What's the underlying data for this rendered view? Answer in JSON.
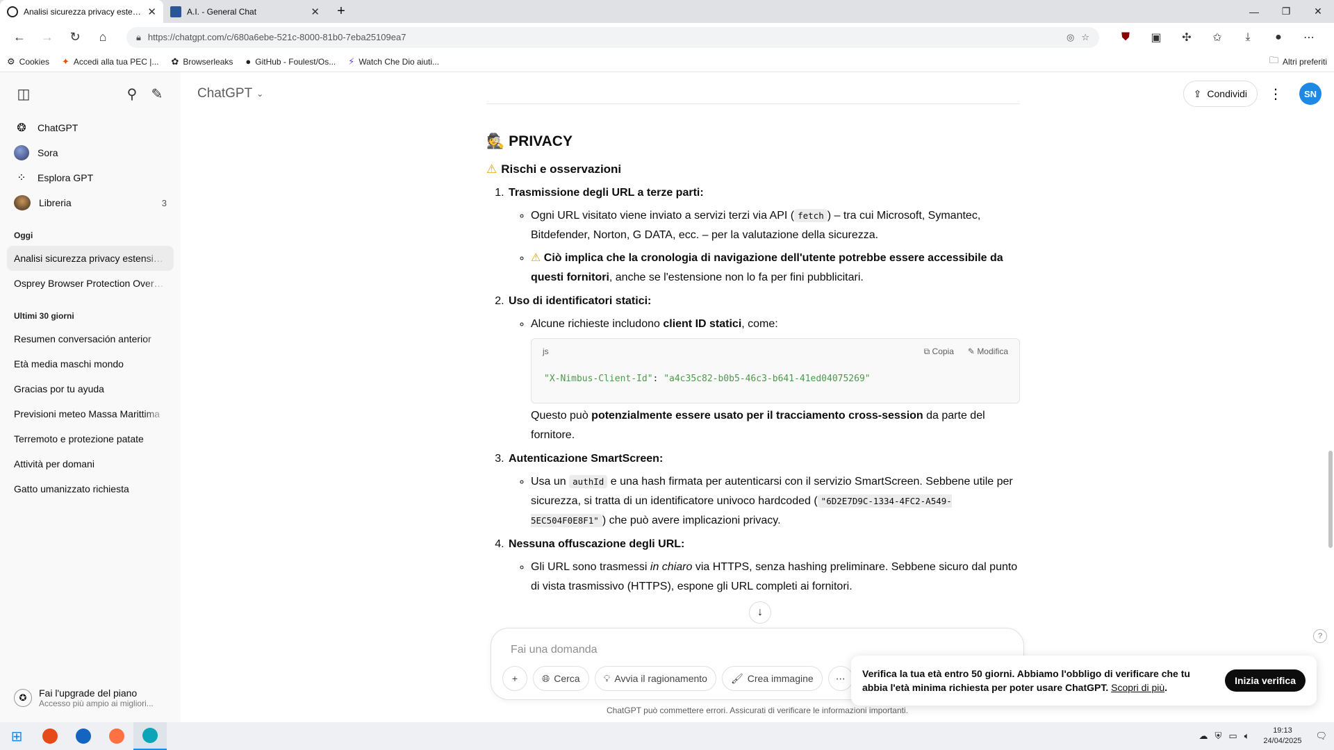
{
  "browser": {
    "tabs": [
      {
        "title": "Analisi sicurezza privacy estensior",
        "active": true
      },
      {
        "title": "A.I. - General Chat",
        "active": false
      }
    ],
    "url": "https://chatgpt.com/c/680a6ebe-521c-8000-81b0-7eba25109ea7",
    "bookmarks": [
      {
        "label": "Cookies",
        "icon": "gear-icon"
      },
      {
        "label": "Accedi alla tua PEC |...",
        "icon": "star-icon"
      },
      {
        "label": "Browserleaks",
        "icon": "blob-icon"
      },
      {
        "label": "GitHub - Foulest/Os...",
        "icon": "github-icon"
      },
      {
        "label": "Watch Che Dio aiuti...",
        "icon": "bolt-icon"
      }
    ],
    "other_bookmarks": "Altri preferiti"
  },
  "sidebar": {
    "items": [
      {
        "label": "ChatGPT"
      },
      {
        "label": "Sora"
      },
      {
        "label": "Esplora GPT"
      },
      {
        "label": "Libreria",
        "count": "3"
      }
    ],
    "sections": [
      {
        "title": "Oggi",
        "chats": [
          "Analisi sicurezza privacy estensione",
          "Osprey Browser Protection Overview"
        ]
      },
      {
        "title": "Ultimi 30 giorni",
        "chats": [
          "Resumen conversación anterior",
          "Età media maschi mondo",
          "Gracias por tu ayuda",
          "Previsioni meteo Massa Marittima",
          "Terremoto e protezione patate",
          "Attività per domani",
          "Gatto umanizzato richiesta"
        ]
      }
    ],
    "upgrade": {
      "title": "Fai l'upgrade del piano",
      "subtitle": "Accesso più ampio ai migliori..."
    }
  },
  "header": {
    "model": "ChatGPT",
    "share": "Condividi",
    "avatar": "SN"
  },
  "content": {
    "heading": "PRIVACY",
    "subheading": "Rischi e osservazioni",
    "p1_title": "Trasmissione degli URL a terze parti:",
    "p1_b1_a": "Ogni URL visitato viene inviato a servizi terzi via API (",
    "p1_b1_code": "fetch",
    "p1_b1_b": ") – tra cui Microsoft, Symantec, Bitdefender, Norton, G DATA, ecc. – per la valutazione della sicurezza.",
    "p1_b2_bold": "Ciò implica che la cronologia di navigazione dell'utente potrebbe essere accessibile da questi fornitori",
    "p1_b2_rest": ", anche se l'estensione non lo fa per fini pubblicitari.",
    "p2_title": "Uso di identificatori statici:",
    "p2_b1_a": "Alcune richieste includono ",
    "p2_b1_bold": "client ID statici",
    "p2_b1_b": ", come:",
    "code_lang": "js",
    "code_copy": "Copia",
    "code_edit": "Modifica",
    "code_line_key": "\"X-Nimbus-Client-Id\"",
    "code_line_sep": ": ",
    "code_line_val": "\"a4c35c82-b0b5-46c3-b641-41ed04075269\"",
    "p2_after_a": "Questo può ",
    "p2_after_bold": "potenzialmente essere usato per il tracciamento cross-session",
    "p2_after_b": " da parte del fornitore.",
    "p3_title": "Autenticazione SmartScreen:",
    "p3_b1_a": "Usa un ",
    "p3_b1_code": "authId",
    "p3_b1_b": " e una hash firmata per autenticarsi con il servizio SmartScreen. Sebbene utile per sicurezza, si tratta di un identificatore univoco hardcoded (",
    "p3_b1_code2": "\"6D2E7D9C-1334-4FC2-A549-5EC504F0E8F1\"",
    "p3_b1_c": ") che può avere implicazioni privacy.",
    "p4_title": "Nessuna offuscazione degli URL:",
    "p4_b1_a": "Gli URL sono trasmessi ",
    "p4_b1_em": "in chiaro",
    "p4_b1_b": " via HTTPS, senza hashing preliminare. Sebbene sicuro dal punto di vista trasmissivo (HTTPS), espone gli URL completi ai fornitori."
  },
  "composer": {
    "placeholder": "Fai una domanda",
    "tools": [
      "Cerca",
      "Avvia il ragionamento",
      "Crea immagine"
    ]
  },
  "disclaimer": "ChatGPT può commettere errori. Assicurati di verificare le informazioni importanti.",
  "verify": {
    "text": "Verifica la tua età entro 50 giorni. Abbiamo l'obbligo di verificare che tu abbia l'età minima richiesta per poter usare ChatGPT.",
    "link": "Scopri di più",
    "button": "Inizia verifica"
  },
  "taskbar": {
    "time": "19:13",
    "date": "24/04/2025"
  },
  "colors": {
    "accent": "#1e88e5",
    "code_green": "#4a9a4a"
  }
}
